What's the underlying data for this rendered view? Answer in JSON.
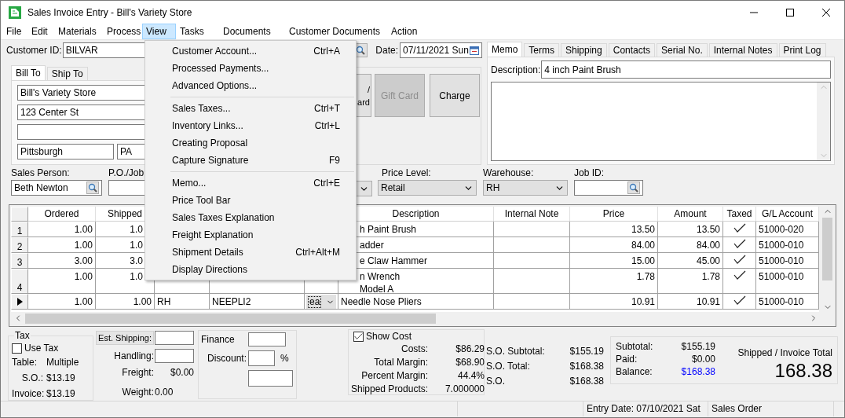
{
  "window": {
    "title": "Sales Invoice Entry - Bill's Variety Store"
  },
  "menu_bar": [
    {
      "label": "File",
      "selected": false
    },
    {
      "label": "Edit",
      "selected": false
    },
    {
      "label": "Materials",
      "selected": false
    },
    {
      "label": "Process",
      "selected": false
    },
    {
      "label": "View",
      "selected": true
    },
    {
      "label": "Tasks",
      "selected": false
    },
    {
      "label": "Documents",
      "selected": false
    },
    {
      "label": "Customer Documents",
      "selected": false
    },
    {
      "label": "Action",
      "selected": false
    }
  ],
  "view_menu": {
    "groups": [
      [
        {
          "label": "Customer Account...",
          "shortcut": "Ctrl+A"
        },
        {
          "label": "Processed Payments..."
        },
        {
          "label": "Advanced Options..."
        }
      ],
      [
        {
          "label": "Sales Taxes...",
          "shortcut": "Ctrl+T"
        },
        {
          "label": "Inventory Links...",
          "shortcut": "Ctrl+L"
        },
        {
          "label": "Creating Proposal"
        },
        {
          "label": "Capture Signature",
          "shortcut": "F9"
        }
      ],
      [
        {
          "label": "Memo...",
          "shortcut": "Ctrl+E"
        },
        {
          "label": "Price Tool Bar"
        },
        {
          "label": "Sales Taxes Explanation"
        },
        {
          "label": "Freight Explanation"
        },
        {
          "label": "Shipment Details",
          "shortcut": "Ctrl+Alt+M"
        },
        {
          "label": "Display Directions"
        }
      ]
    ]
  },
  "header": {
    "customer_id_label": "Customer ID:",
    "customer_id": "BILVAR",
    "date_label": "Date:",
    "date": "07/11/2021 Sun"
  },
  "address_tabs": [
    {
      "label": "Bill To",
      "selected": true
    },
    {
      "label": "Ship To",
      "selected": false
    }
  ],
  "address": {
    "name": "Bill's Variety Store",
    "street": "123 Center St",
    "city": "Pittsburgh",
    "state": "PA"
  },
  "payment_buttons": [
    {
      "label": "/\nard",
      "disabled": false
    },
    {
      "label": "Gift Card",
      "disabled": true
    },
    {
      "label": "Charge",
      "disabled": false
    }
  ],
  "detail_tabs": [
    {
      "label": "Memo",
      "selected": true
    },
    {
      "label": "Terms",
      "selected": false
    },
    {
      "label": "Shipping",
      "selected": false
    },
    {
      "label": "Contacts",
      "selected": false
    },
    {
      "label": "Serial No.",
      "selected": false
    },
    {
      "label": "Internal Notes",
      "selected": false
    },
    {
      "label": "Print Log",
      "selected": false
    }
  ],
  "memo": {
    "description_label": "Description:",
    "description": "4 inch Paint Brush"
  },
  "fields": {
    "sales_person_label": "Sales Person:",
    "sales_person": "Beth Newton",
    "po_label": "P.O./Job",
    "price_level_label": "Price Level:",
    "price_level": "Retail",
    "warehouse_label": "Warehouse:",
    "warehouse": "RH",
    "job_id_label": "Job ID:"
  },
  "table": {
    "columns": [
      {
        "label": "Ordered"
      },
      {
        "label": "Shipped"
      },
      {
        "label": "Description"
      },
      {
        "label": "Internal Note"
      },
      {
        "label": "Price"
      },
      {
        "label": "Amount"
      },
      {
        "label": "Taxed"
      },
      {
        "label": "G/L Account"
      }
    ],
    "rows": [
      {
        "number": "1",
        "selected": false,
        "ordered": "1.00",
        "shipped": "1.0",
        "description": "h Paint Brush",
        "price": "13.50",
        "amount": "13.50",
        "taxed": true,
        "gl_account": "51000-020"
      },
      {
        "number": "2",
        "selected": false,
        "ordered": "1.00",
        "shipped": "1.0",
        "description": "adder",
        "price": "84.00",
        "amount": "84.00",
        "taxed": true,
        "gl_account": "51000-010"
      },
      {
        "number": "3",
        "selected": false,
        "ordered": "3.00",
        "shipped": "3.0",
        "description": "e Claw Hammer",
        "price": "15.00",
        "amount": "45.00",
        "taxed": true,
        "gl_account": "51000-010"
      },
      {
        "number": "4",
        "selected": false,
        "ordered": "1.00",
        "shipped": "1.0",
        "description": "n Wrench\nModel A",
        "price": "1.78",
        "amount": "1.78",
        "taxed": true,
        "gl_account": "51000-010"
      },
      {
        "selected": true,
        "ordered": "1.00",
        "shipped": "1.00",
        "column_3": "RH",
        "column_4": "NEEPLI2",
        "column_5": "ea",
        "description": "Needle Nose Pliers",
        "price": "10.91",
        "amount": "10.91",
        "taxed": true,
        "gl_account": "51000-010"
      }
    ]
  },
  "tax": {
    "title": "Tax",
    "use_tax_label": "Use Tax",
    "use_tax": false,
    "table_label": "Table:",
    "table": "Multiple",
    "so_label": "S.O.:",
    "so": "$13.19",
    "invoice_label": "Invoice:",
    "invoice": "$13.19"
  },
  "shipping": {
    "est_shipping": "Est. Shipping:",
    "handling_label": "Handling:",
    "freight_label": "Freight:",
    "freight": "$0.00",
    "weight_label": "Weight:",
    "weight": "0.00"
  },
  "finance": {
    "finance_label": "Finance",
    "discount_label": "Discount:",
    "percent": "%"
  },
  "cost": {
    "show_cost_label": "Show Cost",
    "show_cost": true,
    "rows": [
      {
        "label": "Costs:",
        "value": "$86.29"
      },
      {
        "label": "Total Margin:",
        "value": "$68.90"
      },
      {
        "label": "Percent Margin:",
        "value": "44.4%"
      },
      {
        "label": "Shipped Products:",
        "value": "7.000000"
      }
    ]
  },
  "so_totals": [
    {
      "label": "S.O. Subtotal:",
      "value": "$155.19"
    },
    {
      "label": "S.O. Total:",
      "value": "$168.38"
    },
    {
      "label": "S.O.",
      "value": "$168.38"
    }
  ],
  "totals": {
    "rows": [
      {
        "label": "Subtotal:",
        "value": "$155.19",
        "kind": "plain"
      },
      {
        "label": "Paid:",
        "value": "$0.00",
        "kind": "plain"
      },
      {
        "label": "Balance:",
        "value": "$168.38",
        "kind": "balance"
      }
    ],
    "grand_label": "Shipped / Invoice Total",
    "grand": "168.38"
  },
  "status_bar": [
    "Entry Date: 07/10/2021 Sat",
    "Sales Order"
  ]
}
